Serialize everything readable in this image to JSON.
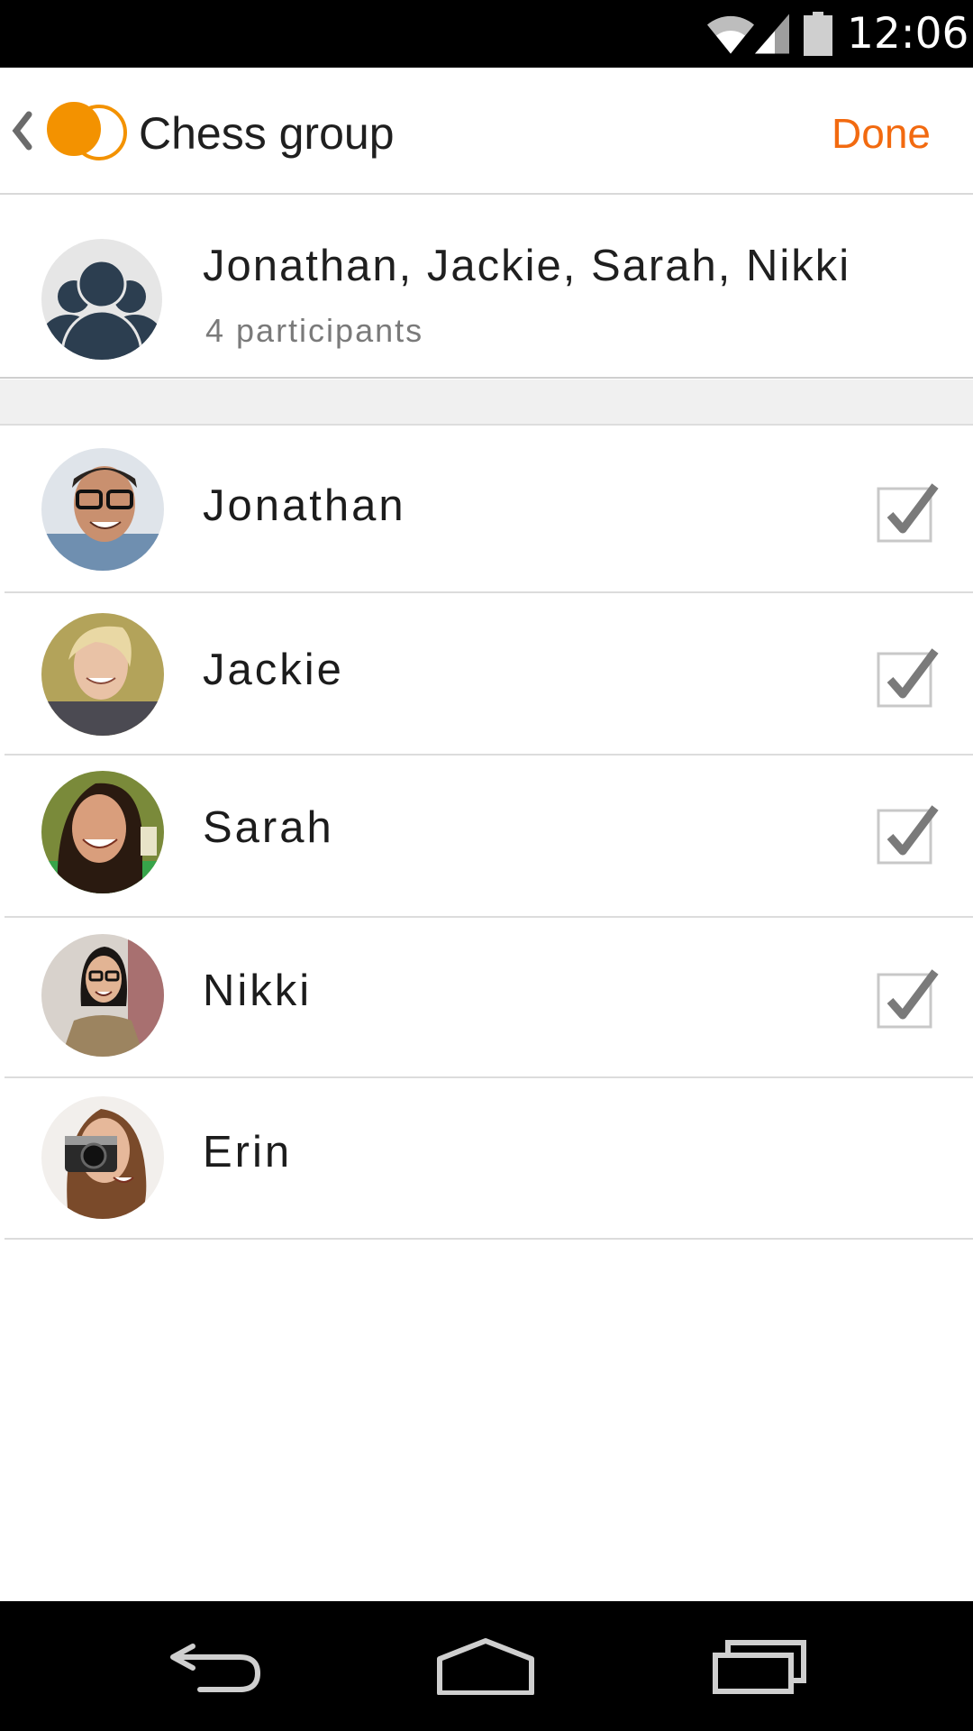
{
  "status_bar": {
    "time": "12:06",
    "icons": [
      "wifi-icon",
      "signal-icon",
      "battery-icon"
    ]
  },
  "app_bar": {
    "back_icon": "chevron-left-icon",
    "logo_icon": "app-logo-icon",
    "title": "Chess group",
    "done_label": "Done",
    "accent_color": "#f26a10"
  },
  "group": {
    "avatar_icon": "group-avatar-icon",
    "names": "Jonathan, Jackie, Sarah, Nikki",
    "participant_count": "4 participants"
  },
  "participants": [
    {
      "name": "Jonathan",
      "checked": true
    },
    {
      "name": "Jackie",
      "checked": true
    },
    {
      "name": "Sarah",
      "checked": true
    },
    {
      "name": "Nikki",
      "checked": true
    },
    {
      "name": "Erin",
      "checked": false
    }
  ],
  "nav_bar": {
    "icons": [
      "back-icon",
      "home-icon",
      "recents-icon"
    ]
  }
}
